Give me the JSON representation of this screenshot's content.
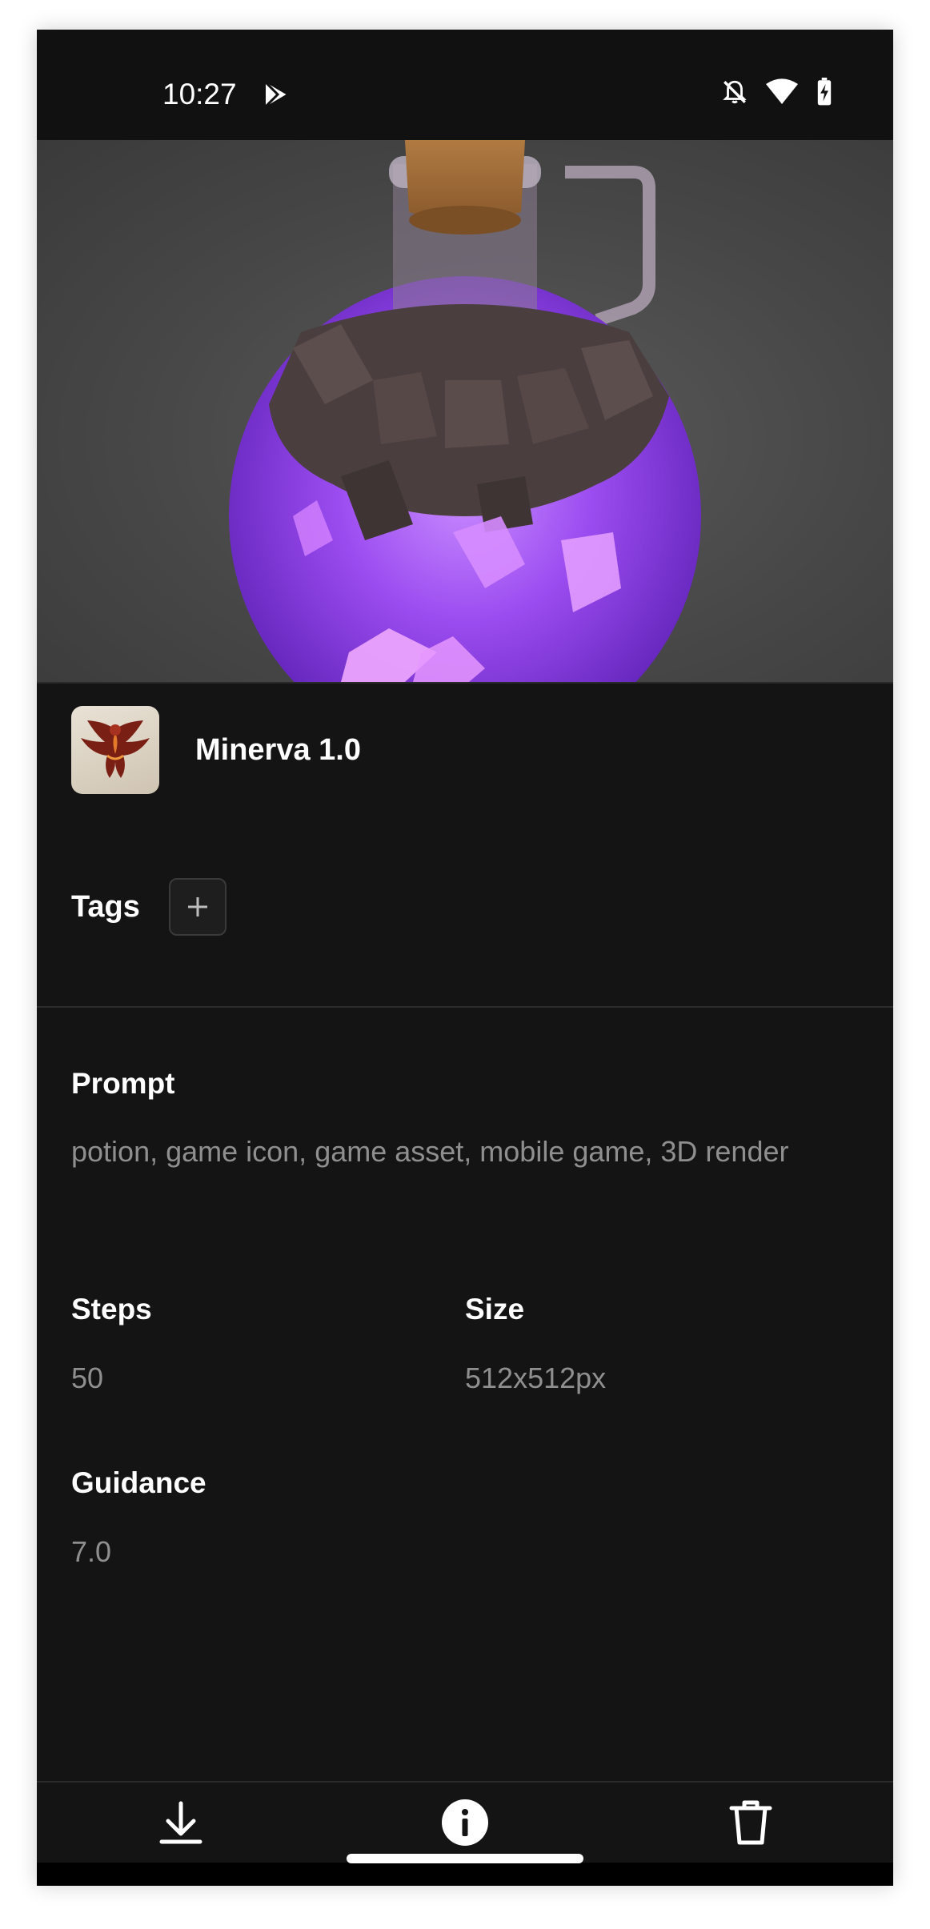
{
  "status_bar": {
    "time": "10:27",
    "icons": [
      "play-store-icon",
      "bell-off-icon",
      "wifi-icon",
      "battery-charging-icon"
    ]
  },
  "hero": {
    "subject": "purple potion bottle image"
  },
  "model": {
    "name": "Minerva 1.0",
    "icon": "phoenix-logo"
  },
  "tags": {
    "label": "Tags",
    "add_icon": "plus-icon"
  },
  "details": {
    "prompt_label": "Prompt",
    "prompt_value": "potion, game icon, game asset, mobile game, 3D render",
    "steps_label": "Steps",
    "steps_value": "50",
    "size_label": "Size",
    "size_value": "512x512px",
    "guidance_label": "Guidance",
    "guidance_value": "7.0"
  },
  "bottom_bar": {
    "items": [
      "download-icon",
      "info-icon",
      "trash-icon"
    ]
  },
  "colors": {
    "background": "#141414",
    "text_primary": "#ffffff",
    "text_secondary": "#8f8f8f",
    "potion_purple": "#9b4cf0"
  }
}
